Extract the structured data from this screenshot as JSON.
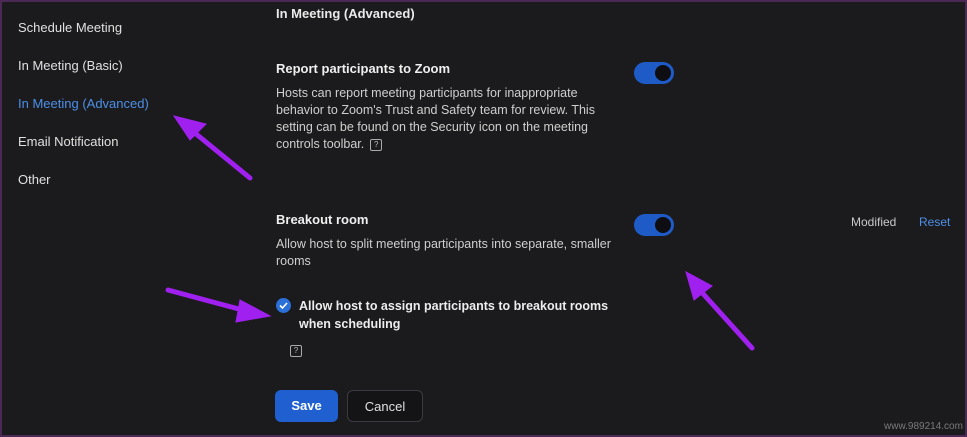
{
  "sidebar": {
    "items": [
      {
        "label": "Schedule Meeting"
      },
      {
        "label": "In Meeting (Basic)"
      },
      {
        "label": "In Meeting (Advanced)"
      },
      {
        "label": "Email Notification"
      },
      {
        "label": "Other"
      }
    ],
    "active_index": 2
  },
  "main": {
    "section_title": "In Meeting (Advanced)",
    "report": {
      "title": "Report participants to Zoom",
      "description": "Hosts can report meeting participants for inappropriate behavior to Zoom's Trust and Safety team for review. This setting can be found on the Security icon on the meeting controls toolbar.",
      "enabled": true
    },
    "breakout": {
      "title": "Breakout room",
      "description": "Allow host to split meeting participants into separate, smaller rooms",
      "enabled": true,
      "modified_label": "Modified",
      "reset_label": "Reset",
      "option_label": "Allow host to assign participants to breakout rooms when scheduling",
      "option_checked": true
    },
    "buttons": {
      "save": "Save",
      "cancel": "Cancel"
    }
  },
  "colors": {
    "accent": "#1e5bc6",
    "link": "#4d8fe6",
    "annotation_arrow": "#a020f0"
  },
  "icons": [
    "help-icon",
    "check-icon",
    "annotation-arrow"
  ],
  "watermark": "www.989214.com"
}
